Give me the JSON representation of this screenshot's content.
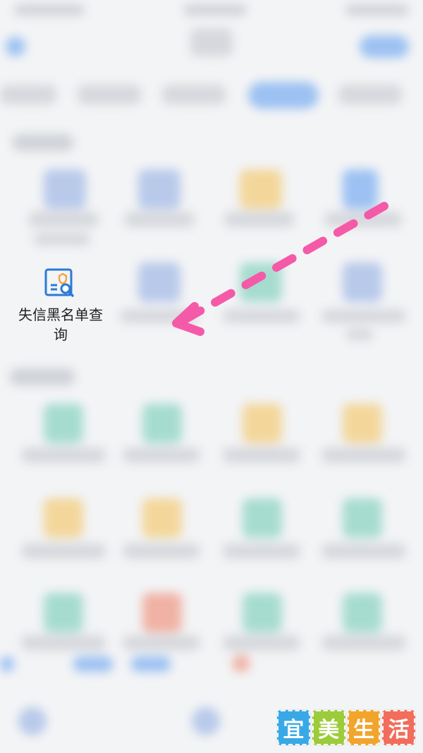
{
  "feature_item": {
    "label": "失信黑名单查询",
    "icon": "blacklist-search-icon"
  },
  "watermark": {
    "chars": [
      "宜",
      "美",
      "生",
      "活"
    ],
    "colors": [
      "#38a9e6",
      "#9ccc3a",
      "#f2a52c",
      "#f26d5c"
    ]
  },
  "colors": {
    "arrow": "#f45aa7",
    "icon_blue": "#2a7ad6",
    "icon_orange": "#f3a33b"
  }
}
